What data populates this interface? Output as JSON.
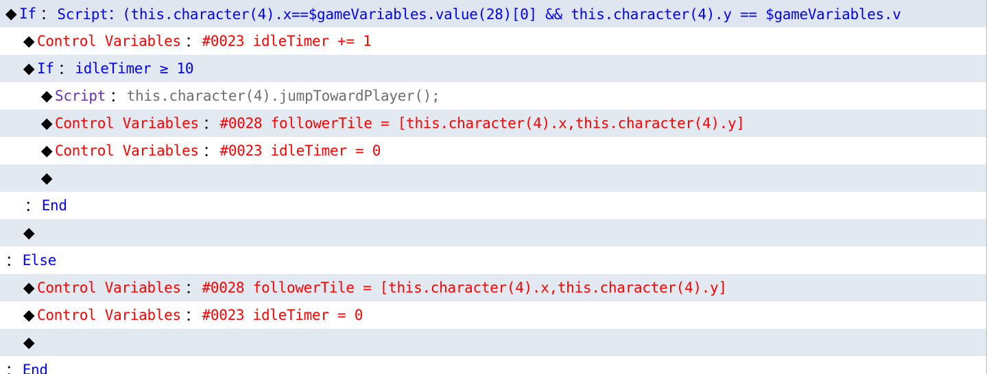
{
  "colors": {
    "command_blue": "#0000ff",
    "command_red": "#ff0000",
    "script_purple": "#6a2fb0",
    "script_gray": "#6f6f6f",
    "row_alt_bg": "#e3e9f1"
  },
  "lines": [
    {
      "diamond": "◆",
      "cmd": "If",
      "sep": "：",
      "arg": "Script：(this.character(4).x==$gameVariables.value(28)[0] && this.character(4).y == $gameVariables.v"
    },
    {
      "diamond": "◆",
      "cmd": "Control Variables",
      "sep": "：",
      "arg": "#0023 idleTimer += 1"
    },
    {
      "diamond": "◆",
      "cmd": "If",
      "sep": "：",
      "arg": "idleTimer ≥ 10"
    },
    {
      "diamond": "◆",
      "cmd": "Script",
      "sep": "：",
      "arg": "this.character(4).jumpTowardPlayer();"
    },
    {
      "diamond": "◆",
      "cmd": "Control Variables",
      "sep": "：",
      "arg": "#0028 followerTile = [this.character(4).x,this.character(4).y]"
    },
    {
      "diamond": "◆",
      "cmd": "Control Variables",
      "sep": "：",
      "arg": "#0023 idleTimer = 0"
    },
    {
      "diamond": "◆"
    },
    {
      "sep": "：",
      "cmd": "End"
    },
    {
      "diamond": "◆"
    },
    {
      "sep": "：",
      "cmd": "Else"
    },
    {
      "diamond": "◆",
      "cmd": "Control Variables",
      "sep": "：",
      "arg": "#0028 followerTile = [this.character(4).x,this.character(4).y]"
    },
    {
      "diamond": "◆",
      "cmd": "Control Variables",
      "sep": "：",
      "arg": "#0023 idleTimer = 0"
    },
    {
      "diamond": "◆"
    },
    {
      "sep": "：",
      "cmd": "End"
    }
  ]
}
